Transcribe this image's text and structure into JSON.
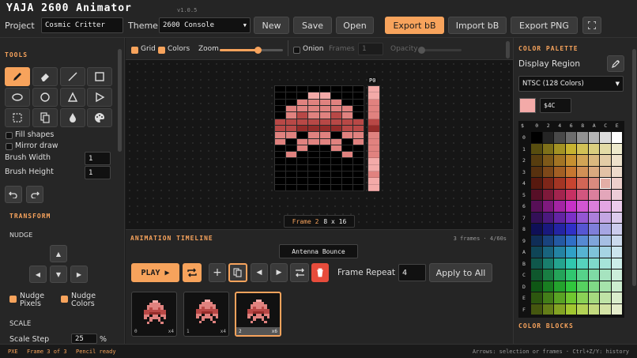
{
  "app": {
    "title": "YAJA 2600 Animator",
    "version": "v1.0.5"
  },
  "header": {
    "project_label": "Project",
    "project_name": "Cosmic Critter",
    "theme_label": "Theme",
    "theme_value": "2600 Console",
    "new": "New",
    "save": "Save",
    "open": "Open",
    "export_bb": "Export bB",
    "import_bb": "Import bB",
    "export_png": "Export PNG"
  },
  "tools": {
    "title": "TOOLS",
    "fill_shapes": "Fill shapes",
    "mirror_draw": "Mirror draw",
    "brush_width_label": "Brush Width",
    "brush_width": "1",
    "brush_height_label": "Brush Height",
    "brush_height": "1"
  },
  "transform": {
    "title": "TRANSFORM",
    "nudge": "NUDGE",
    "nudge_pixels": "Nudge Pixels",
    "nudge_colors": "Nudge Colors",
    "scale": "SCALE",
    "scale_step_label": "Scale Step",
    "scale_step": "25",
    "scale_unit": "%"
  },
  "canvas_bar": {
    "grid": "Grid",
    "colors": "Colors",
    "zoom": "Zoom",
    "zoom_level": 0.6,
    "onion": "Onion",
    "frames": "Frames",
    "frames_value": "1",
    "opacity": "Opacity"
  },
  "canvas": {
    "p0": "P0",
    "frame_label": "Frame 2",
    "frame_size": "8 x 16",
    "colors": {
      "bg": "#000000",
      "light": "#f3aaa8",
      "mid": "#e0827f",
      "dark": "#b84846",
      "deep": "#952c2a"
    }
  },
  "timeline": {
    "title": "ANIMATION TIMELINE",
    "info": "3 frames · 4/60s",
    "anim_name": "Antenna Bounce",
    "play": "PLAY ▶",
    "frame_repeat_label": "Frame Repeat",
    "frame_repeat": "4",
    "apply_all": "Apply to All",
    "thumbs": [
      {
        "index": "0",
        "repeat": "x4"
      },
      {
        "index": "1",
        "repeat": "x4"
      },
      {
        "index": "2",
        "repeat": "x6"
      }
    ]
  },
  "palette": {
    "title": "COLOR PALETTE",
    "display_region": "Display Region",
    "region": "NTSC (128 Colors)",
    "selected_hex": "$4C",
    "selected_color": "#f3aaa8",
    "col_headers": [
      "0",
      "2",
      "4",
      "6",
      "8",
      "A",
      "C",
      "E"
    ],
    "row_headers": [
      "0",
      "1",
      "2",
      "3",
      "4",
      "5",
      "6",
      "7",
      "8",
      "9",
      "A",
      "B",
      "C",
      "D",
      "E",
      "F"
    ],
    "blocks_title": "COLOR BLOCKS"
  },
  "status": {
    "mode": "PXE",
    "frame": "Frame 3 of 3",
    "ready": "Pencil ready",
    "hint": "Arrows: selection or frames · Ctrl+Z/Y: history"
  }
}
